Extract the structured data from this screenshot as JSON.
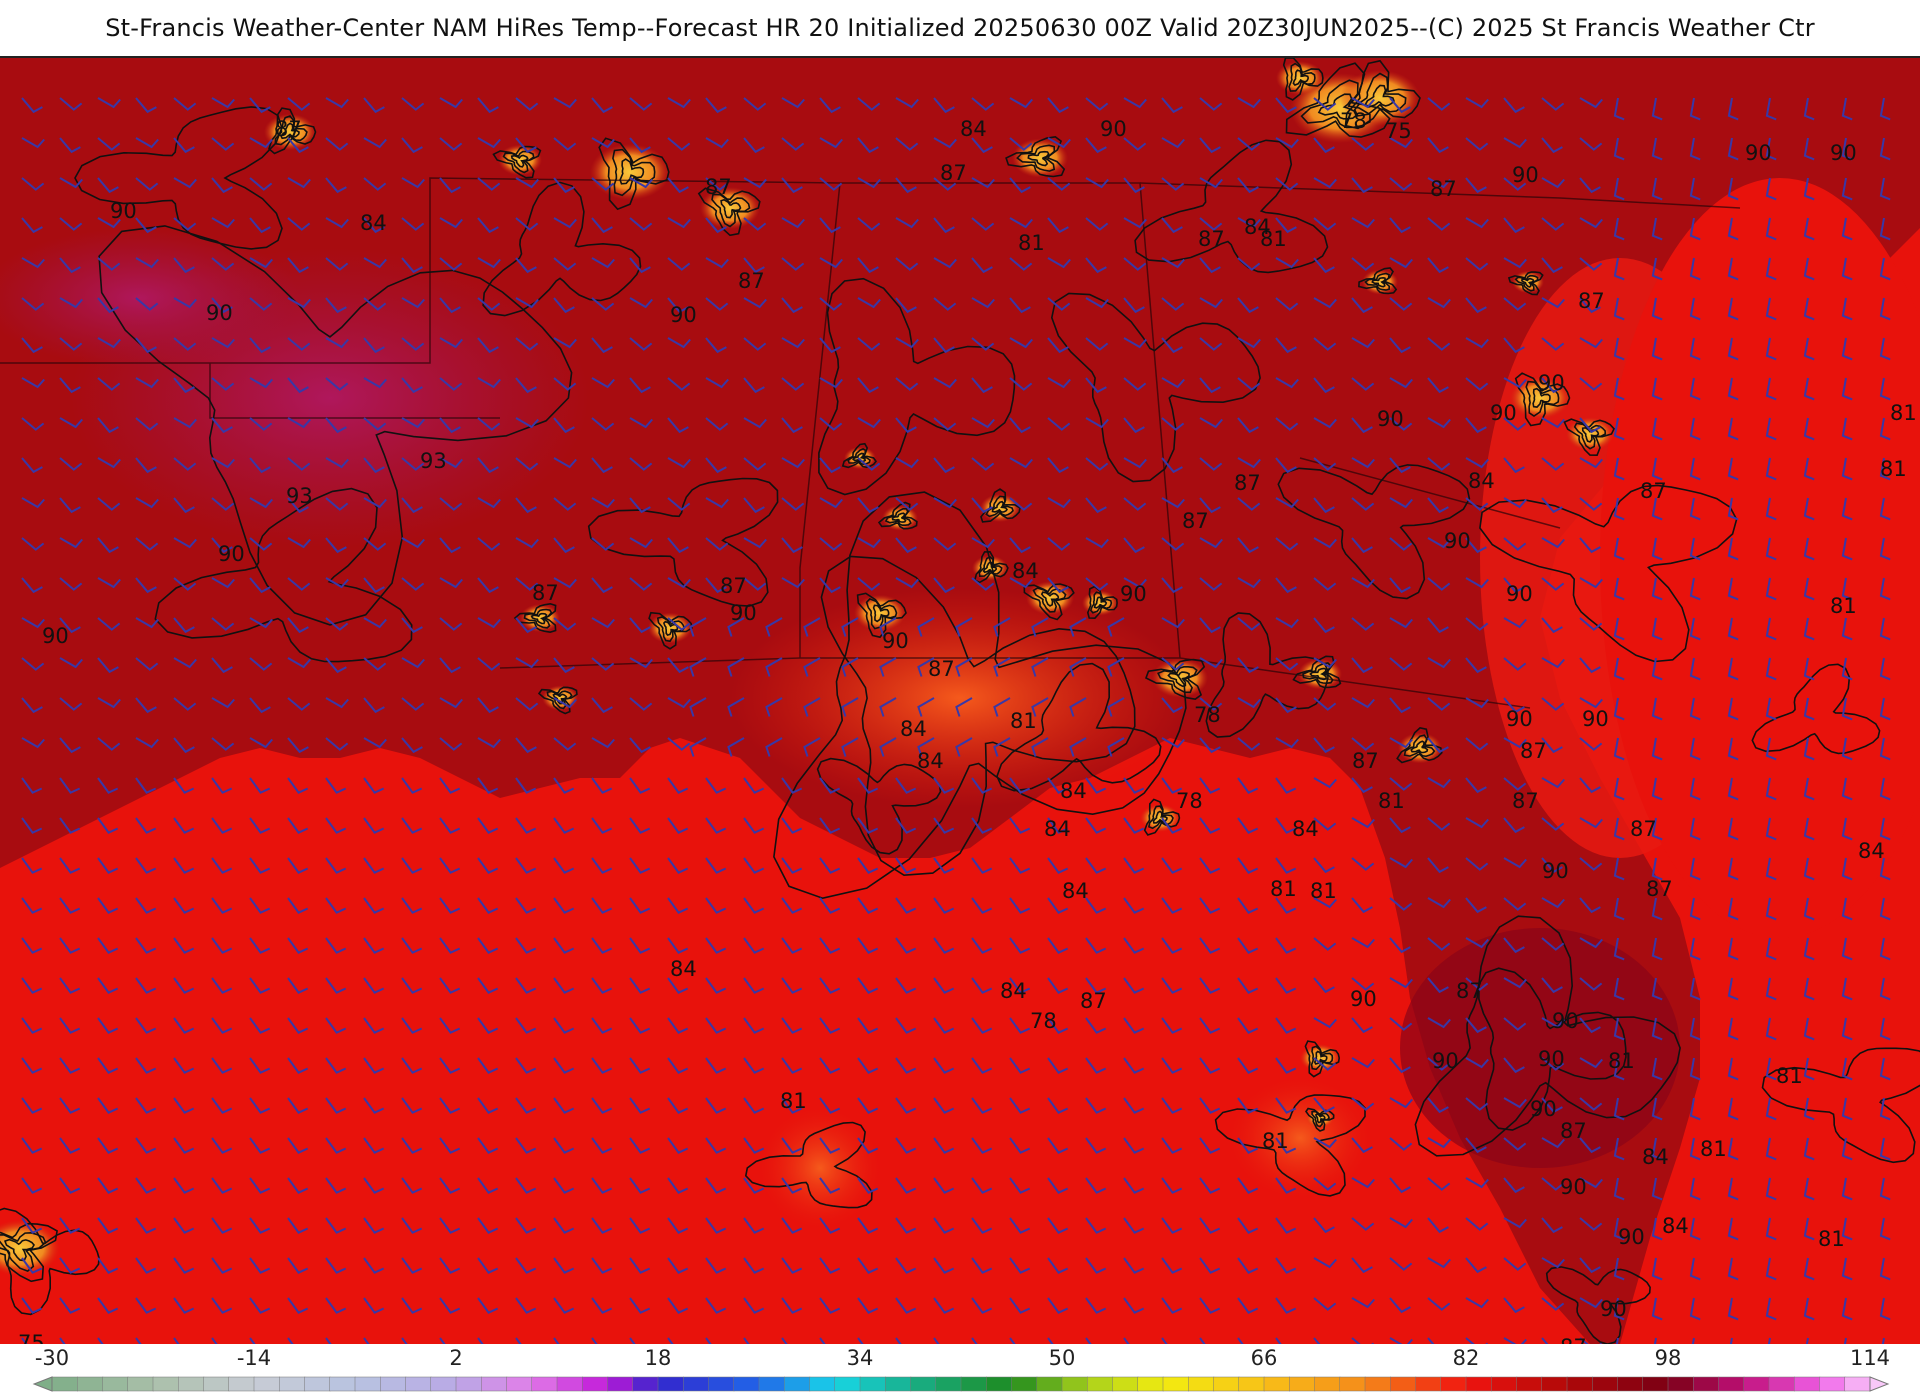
{
  "title": "St-Francis Weather-Center NAM HiRes Temp--Forecast HR 20 Initialized 20250630 00Z Valid 20Z30JUN2025--(C) 2025 St Francis Weather Ctr",
  "colorbar": {
    "tick_labels": [
      "-30",
      "-14",
      "2",
      "18",
      "34",
      "50",
      "66",
      "82",
      "98",
      "114"
    ],
    "stops": [
      {
        "v": -30,
        "c": "#7fae88"
      },
      {
        "v": -22,
        "c": "#a9bfa9"
      },
      {
        "v": -14,
        "c": "#c8ccd4"
      },
      {
        "v": -6,
        "c": "#b8c3e0"
      },
      {
        "v": 2,
        "c": "#b9a9e6"
      },
      {
        "v": 8,
        "c": "#e27ce8"
      },
      {
        "v": 14,
        "c": "#c018d8"
      },
      {
        "v": 18,
        "c": "#3326cc"
      },
      {
        "v": 26,
        "c": "#2166e8"
      },
      {
        "v": 32,
        "c": "#18d6e8"
      },
      {
        "v": 38,
        "c": "#18b08a"
      },
      {
        "v": 46,
        "c": "#1e8a1e"
      },
      {
        "v": 52,
        "c": "#a8d01c"
      },
      {
        "v": 58,
        "c": "#f2ec10"
      },
      {
        "v": 66,
        "c": "#f8c018"
      },
      {
        "v": 74,
        "c": "#f58a1a"
      },
      {
        "v": 82,
        "c": "#f01410"
      },
      {
        "v": 90,
        "c": "#b00808"
      },
      {
        "v": 98,
        "c": "#7a0014"
      },
      {
        "v": 104,
        "c": "#c0107a"
      },
      {
        "v": 110,
        "c": "#f060e8"
      },
      {
        "v": 114,
        "c": "#f8c8f8"
      }
    ]
  },
  "map": {
    "colors": {
      "land": "#a80c10",
      "land_dark": "#8f0614",
      "hot_purple": "#a0144c",
      "gulf": "#e8120c",
      "cool_orange": "#f04018",
      "storm_yellow": "#f5a020",
      "wind_barb": "#3838a8",
      "contour": "#111111"
    },
    "contour_labels": [
      {
        "text": "87"
      },
      {
        "text": "90"
      },
      {
        "text": "84"
      },
      {
        "text": "78"
      },
      {
        "text": "75"
      },
      {
        "text": "87"
      },
      {
        "text": "90"
      },
      {
        "text": "84"
      },
      {
        "text": "87"
      },
      {
        "text": "90"
      },
      {
        "text": "81"
      },
      {
        "text": "87"
      },
      {
        "text": "84"
      },
      {
        "text": "87"
      },
      {
        "text": "90"
      },
      {
        "text": "90"
      },
      {
        "text": "87"
      },
      {
        "text": "90"
      },
      {
        "text": "90"
      },
      {
        "text": "87"
      },
      {
        "text": "81"
      },
      {
        "text": "90"
      },
      {
        "text": "93"
      },
      {
        "text": "93"
      },
      {
        "text": "90"
      },
      {
        "text": "90"
      },
      {
        "text": "87"
      },
      {
        "text": "84"
      },
      {
        "text": "90"
      },
      {
        "text": "87"
      },
      {
        "text": "87"
      },
      {
        "text": "90"
      },
      {
        "text": "90"
      },
      {
        "text": "90"
      },
      {
        "text": "90"
      },
      {
        "text": "90"
      },
      {
        "text": "87"
      },
      {
        "text": "84"
      },
      {
        "text": "90"
      },
      {
        "text": "87"
      },
      {
        "text": "81"
      },
      {
        "text": "84"
      },
      {
        "text": "84"
      },
      {
        "text": "78"
      },
      {
        "text": "81"
      },
      {
        "text": "84"
      },
      {
        "text": "90"
      },
      {
        "text": "87"
      },
      {
        "text": "87"
      },
      {
        "text": "84"
      },
      {
        "text": "87"
      },
      {
        "text": "87"
      },
      {
        "text": "90"
      },
      {
        "text": "81"
      },
      {
        "text": "78"
      },
      {
        "text": "87"
      },
      {
        "text": "84"
      },
      {
        "text": "81"
      },
      {
        "text": "84"
      },
      {
        "text": "78"
      },
      {
        "text": "84"
      },
      {
        "text": "84"
      },
      {
        "text": "81"
      },
      {
        "text": "90"
      },
      {
        "text": "90"
      },
      {
        "text": "87"
      },
      {
        "text": "90"
      },
      {
        "text": "84"
      },
      {
        "text": "81"
      },
      {
        "text": "81"
      },
      {
        "text": "81"
      },
      {
        "text": "81"
      },
      {
        "text": "81"
      },
      {
        "text": "84"
      },
      {
        "text": "90"
      },
      {
        "text": "90"
      },
      {
        "text": "90"
      },
      {
        "text": "84"
      },
      {
        "text": "87"
      },
      {
        "text": "90"
      },
      {
        "text": "87"
      },
      {
        "text": "90"
      },
      {
        "text": "81"
      },
      {
        "text": "81"
      },
      {
        "text": "81"
      },
      {
        "text": "75"
      },
      {
        "text": "81"
      },
      {
        "text": "87"
      },
      {
        "text": "87"
      },
      {
        "text": "90"
      }
    ]
  }
}
